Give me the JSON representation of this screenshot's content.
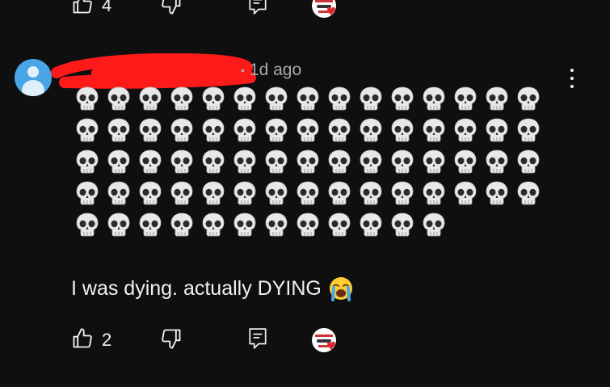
{
  "previous_comment": {
    "like_count": "4"
  },
  "comment": {
    "author": "",
    "timestamp": "1d ago",
    "skull_rows": [
      15,
      15,
      15,
      15,
      12
    ],
    "text": "I was dying. actually DYING",
    "like_count": "2"
  },
  "icons": {
    "like": "thumbs-up-icon",
    "dislike": "thumbs-down-icon",
    "reply": "reply-comment-icon",
    "more": "more-vertical-icon",
    "skull": "skull-emoji",
    "cry": "loudly-crying-emoji",
    "heart": "creator-heart-icon"
  },
  "colors": {
    "background": "#0f0f0f",
    "text": "#f1f1f1",
    "meta": "#aaaaaa",
    "avatar": "#49a5e6",
    "heart": "#e0242f",
    "redaction": "#ff1a1a"
  }
}
